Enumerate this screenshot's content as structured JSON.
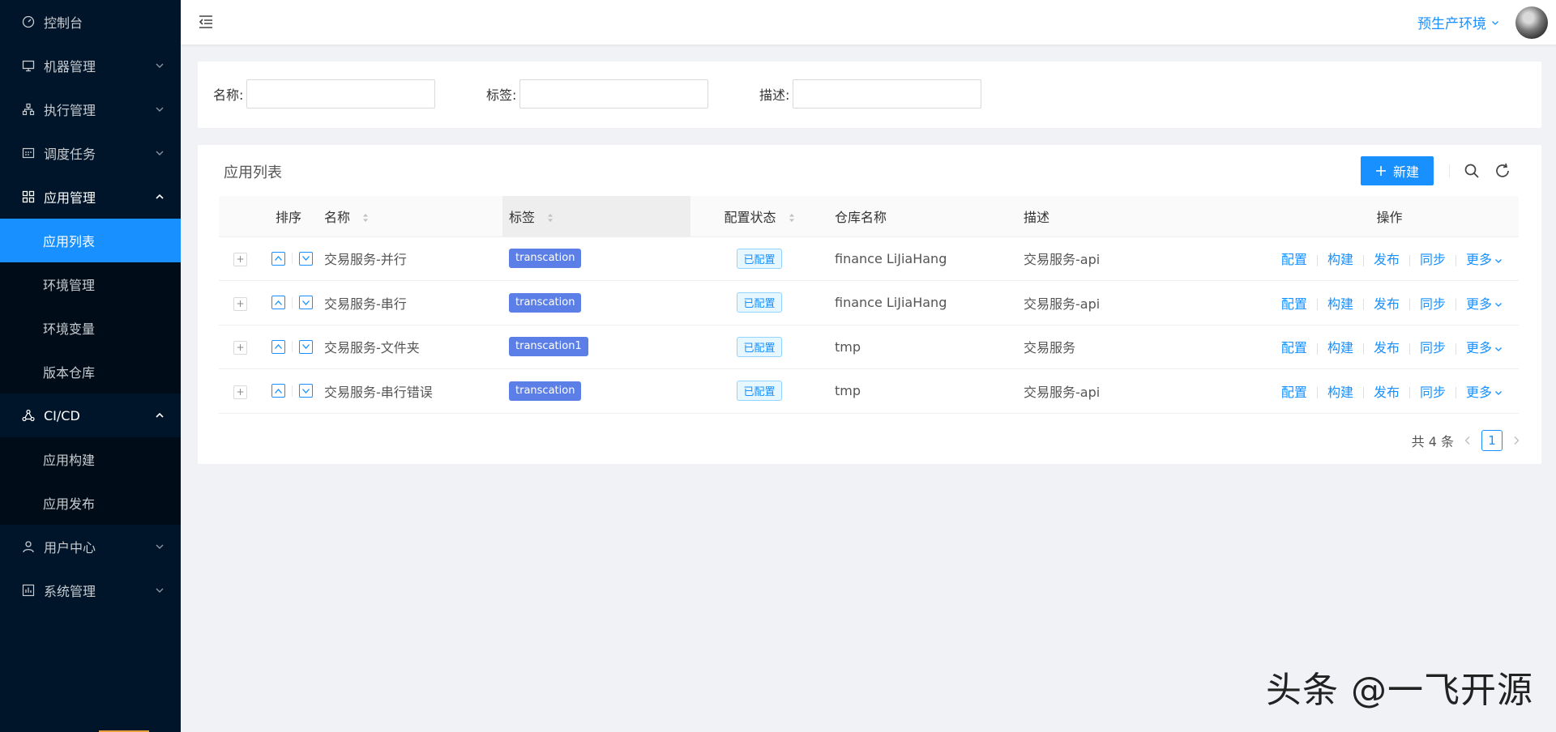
{
  "sidebar": {
    "items": [
      {
        "label": "控制台",
        "icon": "dashboard-icon"
      },
      {
        "label": "机器管理",
        "icon": "monitor-icon"
      },
      {
        "label": "执行管理",
        "icon": "org-tree-icon"
      },
      {
        "label": "调度任务",
        "icon": "schedule-icon"
      },
      {
        "label": "应用管理",
        "icon": "grid-icon"
      },
      {
        "label": "CI/CD",
        "icon": "ci-icon"
      },
      {
        "label": "用户中心",
        "icon": "user-icon"
      },
      {
        "label": "系统管理",
        "icon": "system-icon"
      }
    ],
    "app_sub": [
      "应用列表",
      "环境管理",
      "环境变量",
      "版本仓库"
    ],
    "cicd_sub": [
      "应用构建",
      "应用发布"
    ]
  },
  "header": {
    "env_label": "预生产环境"
  },
  "filters": {
    "name_label": "名称:",
    "tag_label": "标签:",
    "desc_label": "描述:",
    "name_value": "",
    "tag_value": "",
    "desc_value": ""
  },
  "list": {
    "title": "应用列表",
    "new_button": "新建",
    "columns": {
      "order": "排序",
      "name": "名称",
      "tag": "标签",
      "config_status": "配置状态",
      "repo": "仓库名称",
      "desc": "描述",
      "ops": "操作"
    },
    "rows": [
      {
        "name": "交易服务-并行",
        "tag": "transcation",
        "status": "已配置",
        "repo": "finance LiJiaHang",
        "desc": "交易服务-api"
      },
      {
        "name": "交易服务-串行",
        "tag": "transcation",
        "status": "已配置",
        "repo": "finance LiJiaHang",
        "desc": "交易服务-api"
      },
      {
        "name": "交易服务-文件夹",
        "tag": "transcation1",
        "status": "已配置",
        "repo": "tmp",
        "desc": "交易服务"
      },
      {
        "name": "交易服务-串行错误",
        "tag": "transcation",
        "status": "已配置",
        "repo": "tmp",
        "desc": "交易服务-api"
      }
    ],
    "actions": {
      "config": "配置",
      "build": "构建",
      "publish": "发布",
      "sync": "同步",
      "more": "更多"
    },
    "pagination": {
      "total_text": "共 4 条",
      "current_page": "1"
    }
  },
  "watermark": "头条 @一飞开源",
  "colors": {
    "sidebar_bg": "#001529",
    "primary": "#1890ff",
    "tag_bg": "#5b7fe6"
  }
}
